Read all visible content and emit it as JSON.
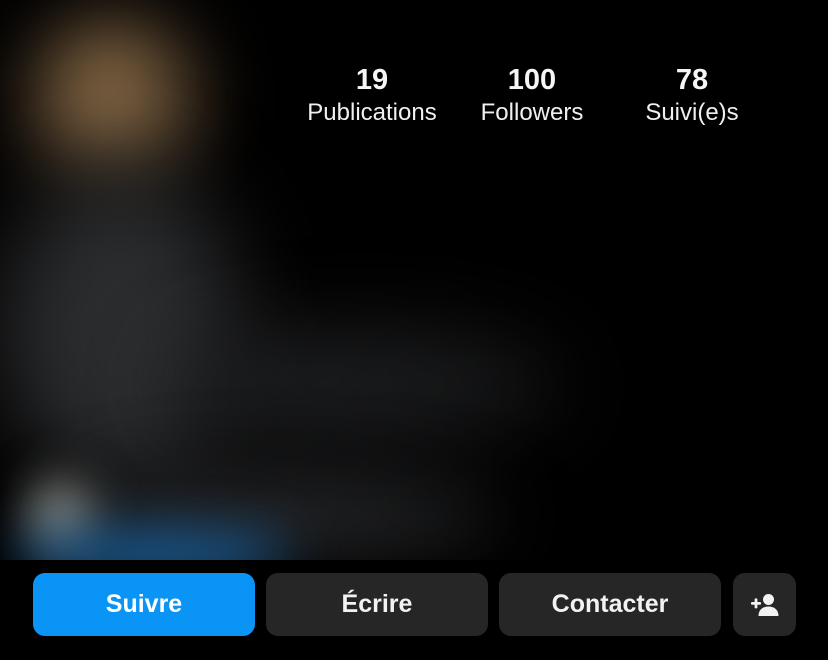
{
  "profile": {
    "stats": [
      {
        "value": "19",
        "label": "Publications"
      },
      {
        "value": "100",
        "label": "Followers"
      },
      {
        "value": "78",
        "label": "Suivi(e)s"
      }
    ]
  },
  "actions": {
    "follow_label": "Suivre",
    "message_label": "Écrire",
    "contact_label": "Contacter",
    "add_user_icon": "add-person-icon"
  },
  "colors": {
    "background": "#000000",
    "primary_button": "#0a95f6",
    "secondary_button": "#262626"
  }
}
